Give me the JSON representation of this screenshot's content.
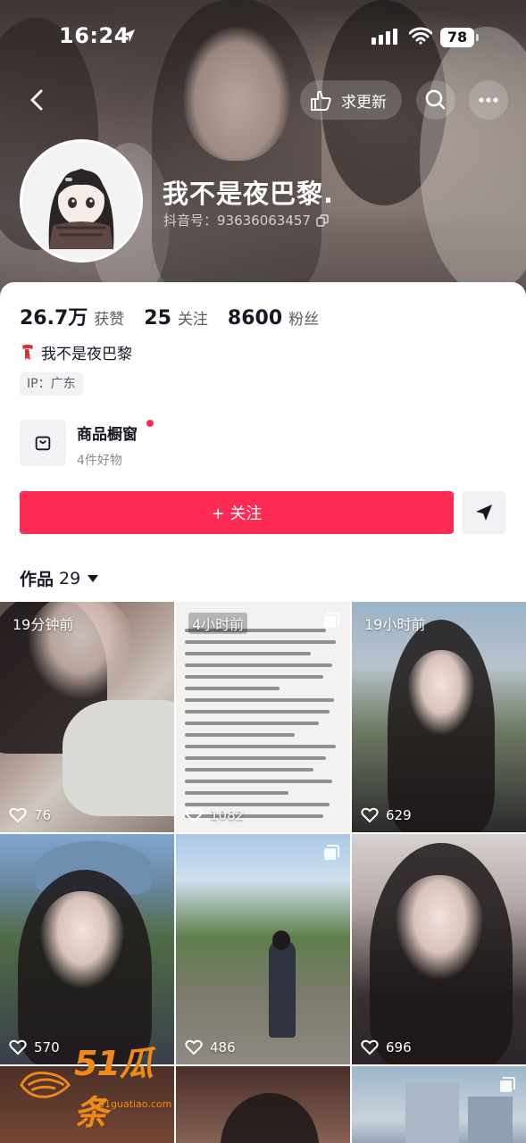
{
  "status_bar": {
    "time": "16:24",
    "battery": "78"
  },
  "header": {
    "update_label": "求更新",
    "name": "我不是夜巴黎.",
    "douyin_id": "抖音号：93636063457"
  },
  "stats": [
    {
      "value": "26.7万",
      "label": "获赞"
    },
    {
      "value": "25",
      "label": "关注"
    },
    {
      "value": "8600",
      "label": "粉丝"
    }
  ],
  "bio": "我不是夜巴黎",
  "ip_tag": "IP：广东",
  "shop": {
    "title": "商品橱窗",
    "subtitle": "4件好物"
  },
  "follow_button": "+ 关注",
  "works_tab": {
    "label": "作品",
    "count": "29"
  },
  "videos": [
    {
      "time": "19分钟前",
      "likes": "76",
      "multi": false
    },
    {
      "time": "4小时前",
      "likes": "1082",
      "multi": true
    },
    {
      "time": "19小时前",
      "likes": "629",
      "multi": false
    },
    {
      "time": "",
      "likes": "570",
      "multi": false
    },
    {
      "time": "",
      "likes": "486",
      "multi": true
    },
    {
      "time": "",
      "likes": "696",
      "multi": false
    },
    {
      "time": "",
      "likes": "",
      "multi": false
    },
    {
      "time": "",
      "likes": "",
      "multi": false
    },
    {
      "time": "",
      "likes": "",
      "multi": true
    }
  ],
  "watermark": {
    "brand": "51瓜条",
    "url": "51guatiao.com"
  },
  "colors": {
    "accent": "#fe2c55",
    "watermark": "#f08a17"
  }
}
